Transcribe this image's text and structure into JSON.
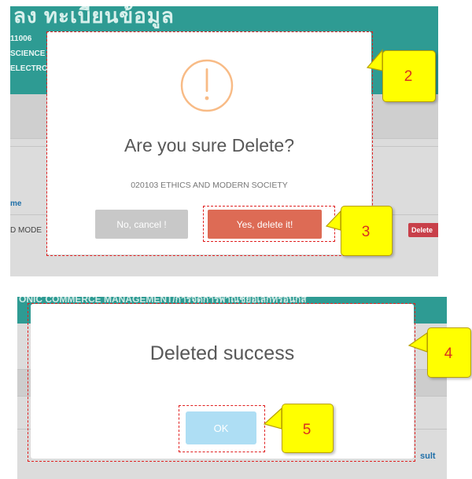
{
  "panel1": {
    "header_title": "ลง ทะเบียนข้อมูล",
    "header_codes": [
      "11006",
      "SCIENCE",
      "ELECTRON"
    ],
    "column_header": "me",
    "row_cell": "D MODE",
    "row_badge": "Delete"
  },
  "confirm_dialog": {
    "icon": "warning-exclamation-icon",
    "title": "Are you sure Delete?",
    "subtitle": "020103 ETHICS AND MODERN SOCIETY",
    "cancel_label": "No, cancel !",
    "confirm_label": "Yes, delete it!",
    "colors": {
      "icon": "#f8bb86",
      "confirm": "#dd6b55",
      "cancel": "#c8c8c8"
    }
  },
  "panel2": {
    "header_text": "ONIC COMMERCE MANAGEMENT/การจัดการพาณิชย์อิเล็กทรอนิกส์",
    "edge_text": "sult"
  },
  "success_dialog": {
    "title": "Deleted success",
    "ok_label": "OK",
    "colors": {
      "ok": "#aedef4"
    }
  },
  "callouts": {
    "c2": "2",
    "c3": "3",
    "c4": "4",
    "c5": "5",
    "color": "#ffff00"
  }
}
